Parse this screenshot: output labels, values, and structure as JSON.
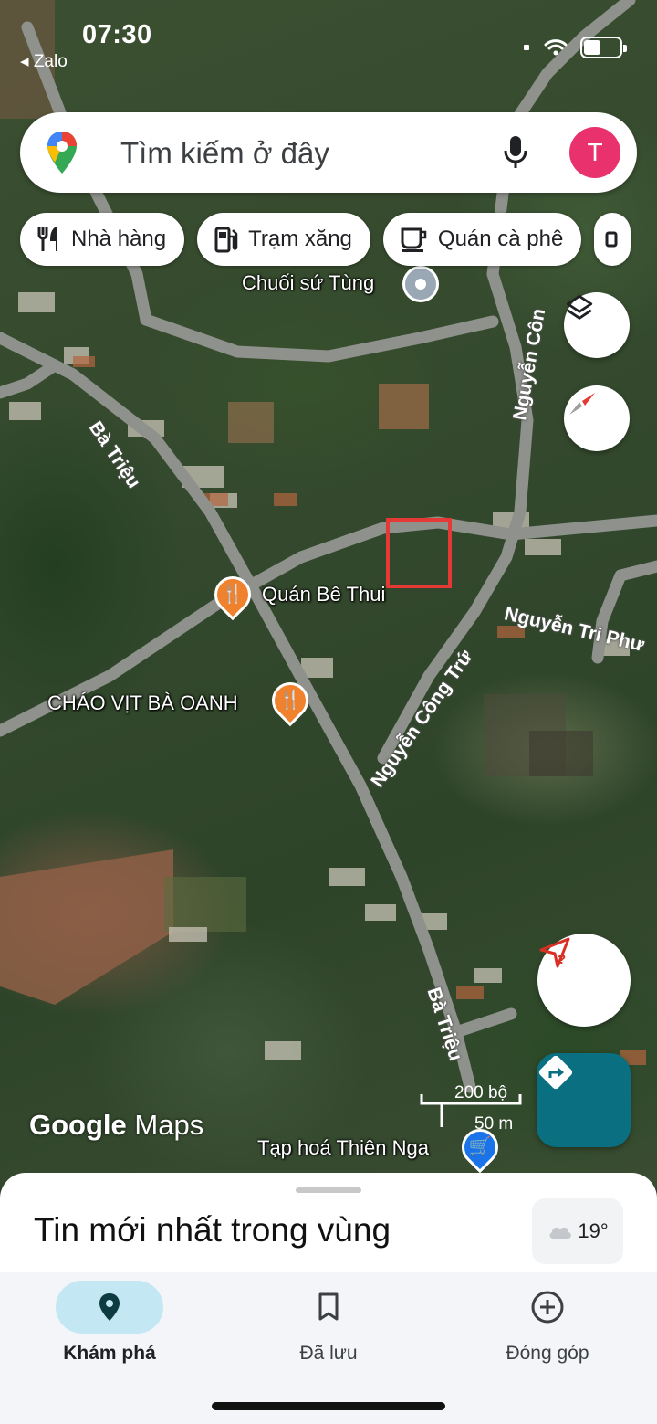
{
  "status_bar": {
    "time": "07:30",
    "back_app": "◂ Zalo"
  },
  "search": {
    "placeholder": "Tìm kiếm ở đây",
    "avatar_initial": "T"
  },
  "chips": [
    {
      "label": "Nhà hàng",
      "icon": "restaurant-icon"
    },
    {
      "label": "Trạm xăng",
      "icon": "gas-station-icon"
    },
    {
      "label": "Quán cà phê",
      "icon": "coffee-icon"
    }
  ],
  "map": {
    "places": {
      "chuoi_su_tung": "Chuối sứ Tùng",
      "quan_be_thui": "Quán Bê Thui",
      "chao_vit": "CHÁO VỊT BÀ OANH",
      "tap_hoa": "Tạp hoá Thiên Nga"
    },
    "roads": {
      "ba_trieu_top": "Bà Triệu",
      "ba_trieu_bottom": "Bà Triệu",
      "nguyen_cong_tru_top": "Nguyễn Côn",
      "nguyen_cong_tru": "Nguyễn Công Trứ",
      "nguyen_tri_phuong": "Nguyễn Tri Phư"
    },
    "attribution": {
      "brand": "Google",
      "product": "Maps"
    },
    "scale": {
      "imperial": "200 bộ",
      "metric": "50 m"
    }
  },
  "sheet": {
    "title": "Tin mới nhất trong vùng",
    "temperature": "19°"
  },
  "nav": {
    "items": [
      {
        "label": "Khám phá",
        "icon": "explore-pin-icon",
        "active": true
      },
      {
        "label": "Đã lưu",
        "icon": "bookmark-icon",
        "active": false
      },
      {
        "label": "Đóng góp",
        "icon": "add-circle-icon",
        "active": false
      }
    ]
  },
  "colors": {
    "accent_teal": "#0b6f82",
    "avatar": "#e8316d",
    "nav_active": "#c3e8f3",
    "selection_box": "#e53935",
    "poi_orange": "#f0812d"
  }
}
